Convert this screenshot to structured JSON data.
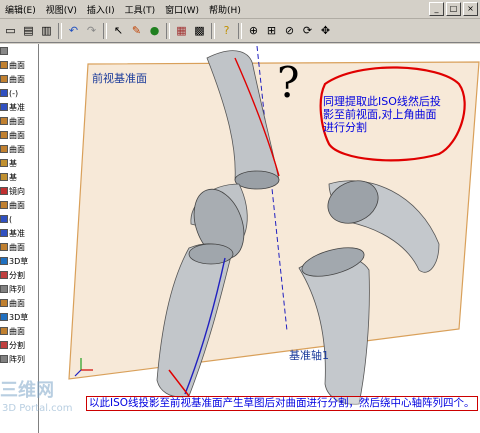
{
  "menu": {
    "items": [
      "编辑(E)",
      "视图(V)",
      "插入(I)",
      "工具(T)",
      "窗口(W)",
      "帮助(H)"
    ]
  },
  "window_controls": [
    "_",
    "□",
    "×"
  ],
  "toolbar": {
    "icons": [
      "new-icon",
      "open-icon",
      "print-icon",
      "undo-icon",
      "redo-icon",
      "select-icon",
      "sketch-icon",
      "rebuild-icon",
      "options-icon",
      "help-icon",
      "zoom-fit-icon",
      "zoom-area-icon",
      "zoom-icon",
      "rotate-icon",
      "pan-icon"
    ]
  },
  "tree": {
    "items": [
      {
        "label": "",
        "icon": "part-icon"
      },
      {
        "label": "曲面",
        "icon": "surface-icon"
      },
      {
        "label": "曲面",
        "icon": "surface-icon"
      },
      {
        "label": "(-)",
        "icon": "sketch-icon"
      },
      {
        "label": "基准",
        "icon": "axis-icon"
      },
      {
        "label": "曲面",
        "icon": "surface-icon"
      },
      {
        "label": "曲面",
        "icon": "surface-icon"
      },
      {
        "label": "曲面",
        "icon": "surface-icon"
      },
      {
        "label": "基",
        "icon": "feature-icon"
      },
      {
        "label": "基",
        "icon": "feature-icon"
      },
      {
        "label": "镜向",
        "icon": "mirror-icon"
      },
      {
        "label": "曲面",
        "icon": "surface-icon"
      },
      {
        "label": "(",
        "icon": "sketch-icon"
      },
      {
        "label": "基准",
        "icon": "axis-icon"
      },
      {
        "label": "曲面",
        "icon": "surface-icon"
      },
      {
        "label": "3D草",
        "icon": "sketch3d-icon"
      },
      {
        "label": "分割",
        "icon": "split-icon"
      },
      {
        "label": "阵列",
        "icon": "pattern-icon"
      },
      {
        "label": "曲面",
        "icon": "surface-icon"
      },
      {
        "label": "3D草",
        "icon": "sketch3d-icon"
      },
      {
        "label": "曲面",
        "icon": "surface-icon"
      },
      {
        "label": "分割",
        "icon": "split-icon"
      },
      {
        "label": "阵列",
        "icon": "pattern-icon"
      }
    ]
  },
  "viewport": {
    "plane_label": "前视基准面",
    "axis_label": "基准轴1",
    "question_mark": "?",
    "callout_top": "同理提取此ISO线然后投影至前视面,对上角曲面进行分割",
    "callout_bottom": "以此ISO线投影至前视基准面产生草图后对曲面进行分割，然后绕中心轴阵列四个。"
  },
  "watermark": {
    "line1": "三维网",
    "line2": "3D Portal.com"
  },
  "colors": {
    "annotation_text": "#0000e0",
    "callout_border": "#e00000",
    "plane_edge": "#d9a05a",
    "plane_fill": "#f7e9d8",
    "surface": "#bfc3c7",
    "iso_line_red": "#e00000",
    "iso_line_blue": "#2020c0"
  }
}
